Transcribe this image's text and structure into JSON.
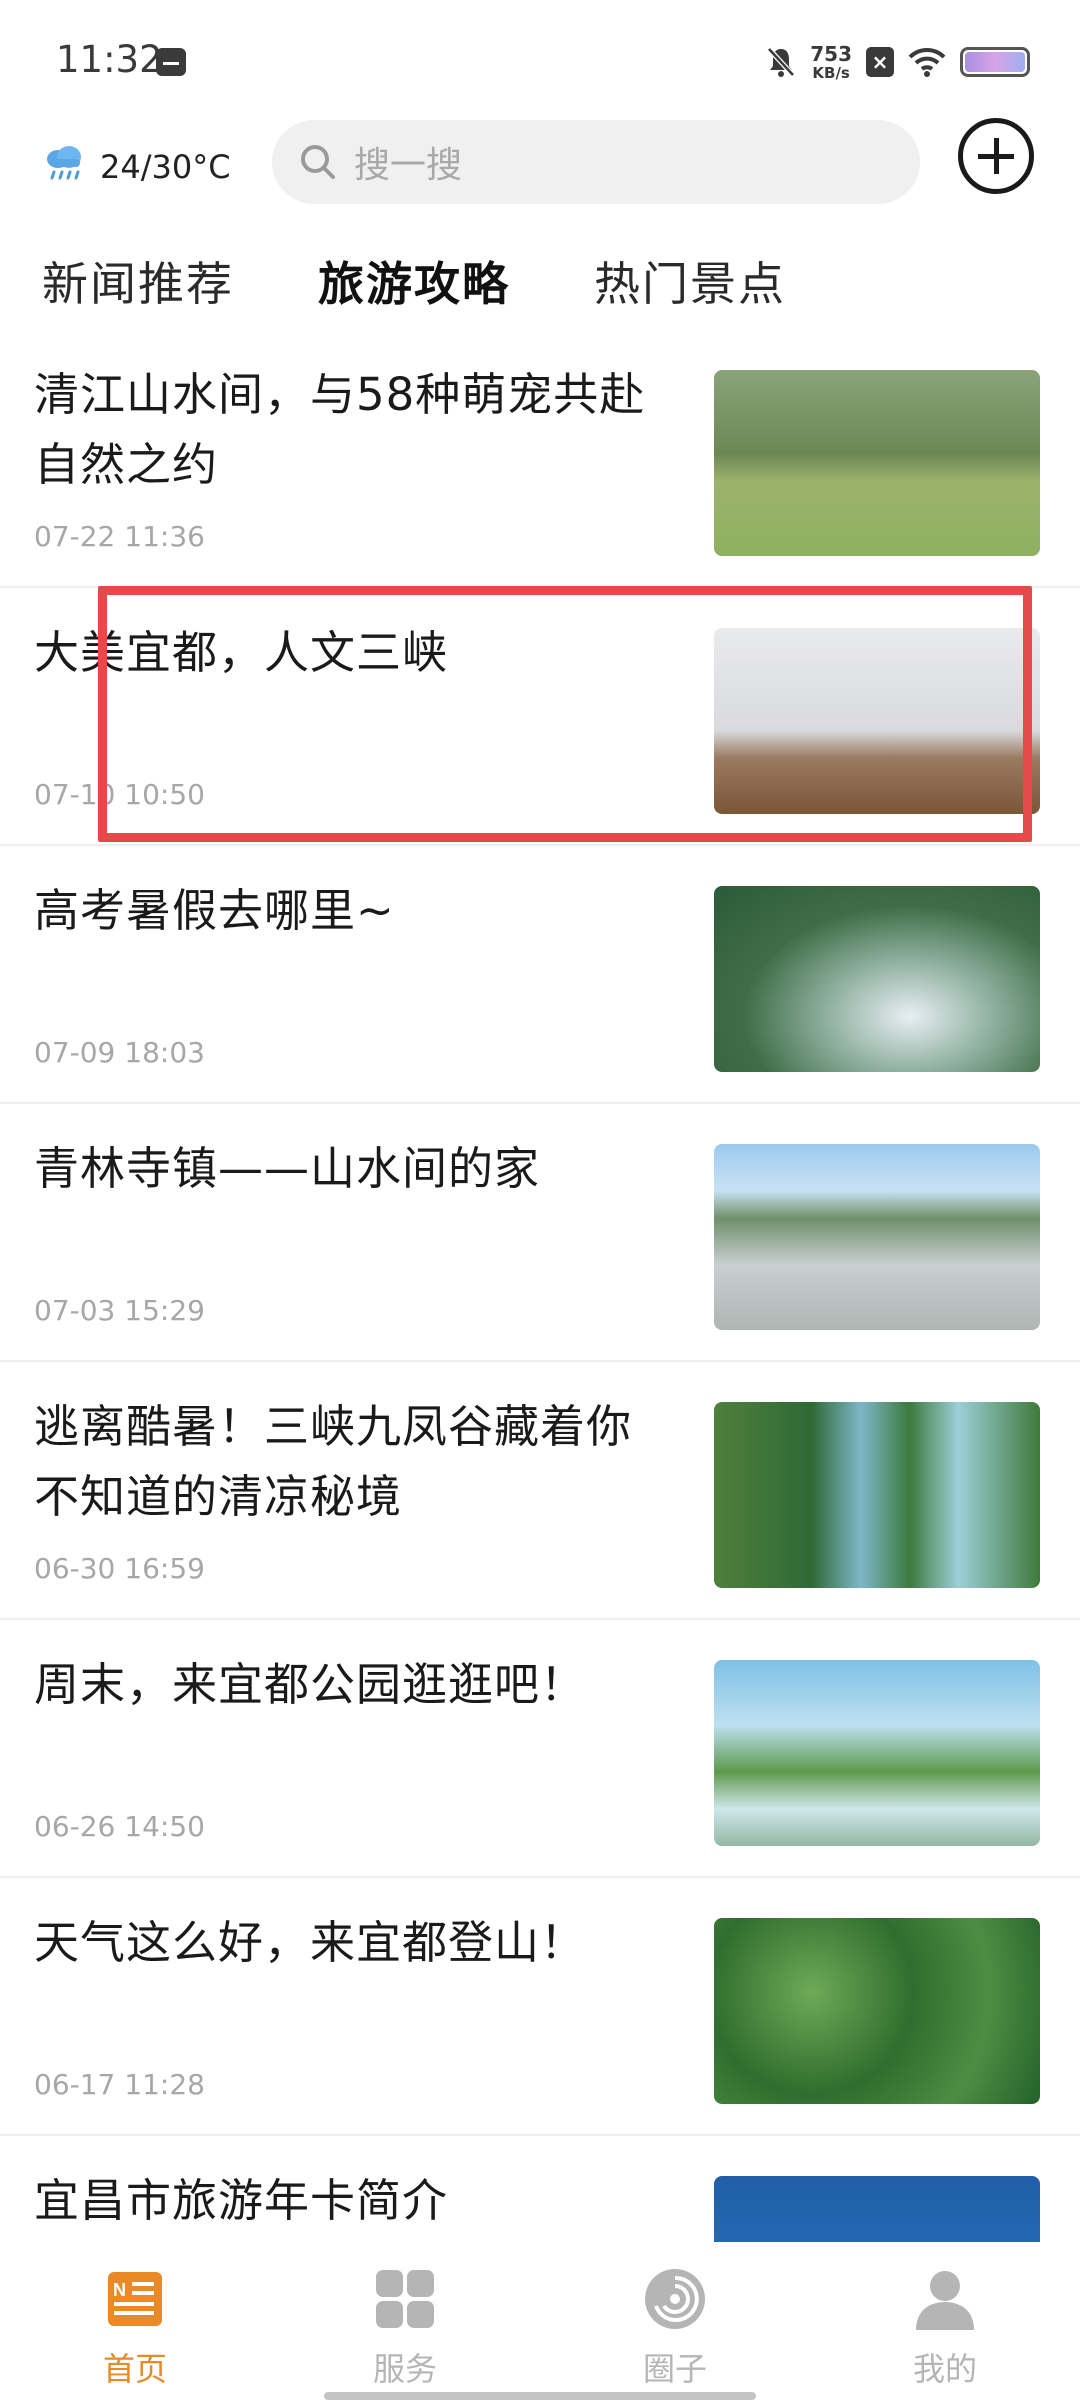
{
  "status_bar": {
    "time": "11:32",
    "net_speed_value": "753",
    "net_speed_unit": "KB/s"
  },
  "weather": {
    "icon": "rain-cloud-icon",
    "temperature": "24/30°C"
  },
  "search": {
    "placeholder": "搜一搜"
  },
  "tabs": [
    {
      "label": "新闻推荐",
      "active": false
    },
    {
      "label": "旅游攻略",
      "active": true
    },
    {
      "label": "热门景点",
      "active": false
    }
  ],
  "news": [
    {
      "title": "清江山水间，与58种萌宠共赴自然之约",
      "date": "07-22 11:36"
    },
    {
      "title": "大美宜都，人文三峡",
      "date": "07-10 10:50"
    },
    {
      "title": "高考暑假去哪里~",
      "date": "07-09 18:03"
    },
    {
      "title": "青林寺镇——山水间的家",
      "date": "07-03 15:29"
    },
    {
      "title": "逃离酷暑！三峡九凤谷藏着你不知道的清凉秘境",
      "date": "06-30 16:59"
    },
    {
      "title": "周末，来宜都公园逛逛吧！",
      "date": "06-26 14:50"
    },
    {
      "title": "天气这么好，来宜都登山！",
      "date": "06-17 11:28"
    },
    {
      "title": "宜昌市旅游年卡简介",
      "date": ""
    }
  ],
  "bottom_nav": [
    {
      "label": "首页",
      "icon": "news-icon",
      "active": true
    },
    {
      "label": "服务",
      "icon": "grid-icon",
      "active": false
    },
    {
      "label": "圈子",
      "icon": "swirl-icon",
      "active": false
    },
    {
      "label": "我的",
      "icon": "person-icon",
      "active": false
    }
  ],
  "colors": {
    "accent": "#e98a27",
    "highlight": "#e64949",
    "inactive": "#b5b5b5"
  }
}
